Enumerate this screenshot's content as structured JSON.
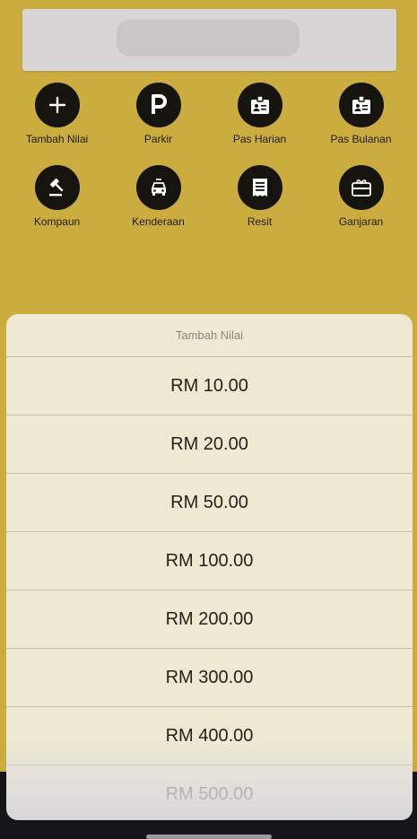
{
  "menu": [
    {
      "label": "Tambah Nilai",
      "icon": "plus-icon"
    },
    {
      "label": "Parkir",
      "icon": "parking-icon"
    },
    {
      "label": "Pas Harian",
      "icon": "id-badge-icon"
    },
    {
      "label": "Pas Bulanan",
      "icon": "id-badge-icon"
    },
    {
      "label": "Kompaun",
      "icon": "gavel-icon"
    },
    {
      "label": "Kenderaan",
      "icon": "car-icon"
    },
    {
      "label": "Resit",
      "icon": "receipt-icon"
    },
    {
      "label": "Ganjaran",
      "icon": "gift-card-icon"
    }
  ],
  "sheet": {
    "title": "Tambah Nilai",
    "options": [
      "RM 10.00",
      "RM 20.00",
      "RM 50.00",
      "RM 100.00",
      "RM 200.00",
      "RM 300.00",
      "RM 400.00",
      "RM 500.00"
    ]
  },
  "colors": {
    "background": "#cbad3f",
    "icon_circle": "#15140f",
    "sheet": "#efe9d3",
    "divider": "#c7c1ac"
  }
}
